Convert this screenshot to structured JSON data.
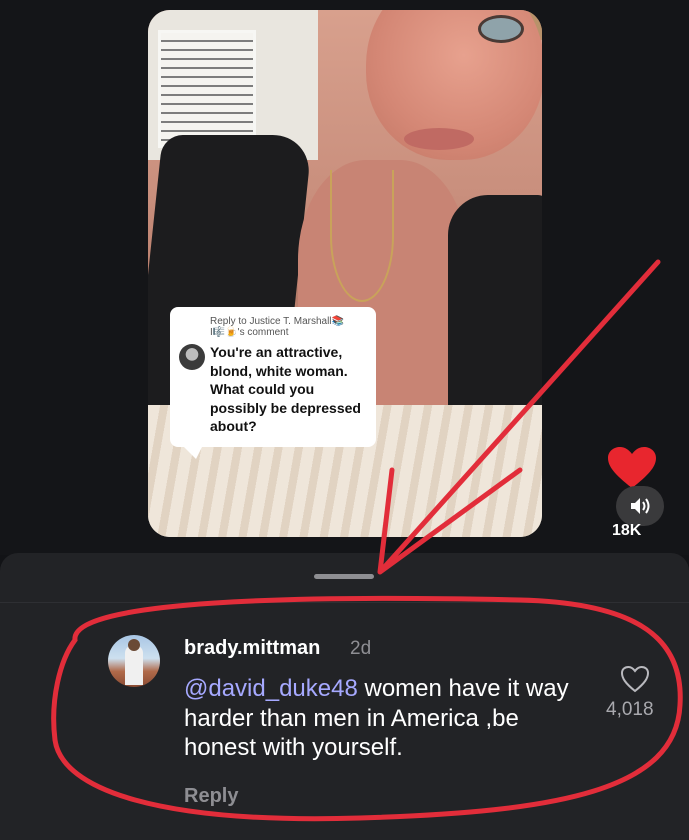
{
  "video": {
    "reply_to": "Reply to Justice T. Marshall📚 I🎼🍺's comment",
    "question": "You're an attractive, blond, white woman. What could you possibly be depressed about?"
  },
  "actions": {
    "like_count": "18K",
    "like_icon": "heart-icon",
    "sound_icon": "speaker-icon"
  },
  "comment": {
    "username": "brady.mittman",
    "time": "2d",
    "mention": "@david_duke48",
    "text": " women have it way harder than men in America ,be honest with yourself.",
    "likes": "4,018",
    "reply_label": "Reply"
  },
  "colors": {
    "background": "#121316",
    "sheet": "#222326",
    "mention": "#a6a9ff",
    "heart": "#e8262e",
    "annotation": "#e22d3a"
  }
}
